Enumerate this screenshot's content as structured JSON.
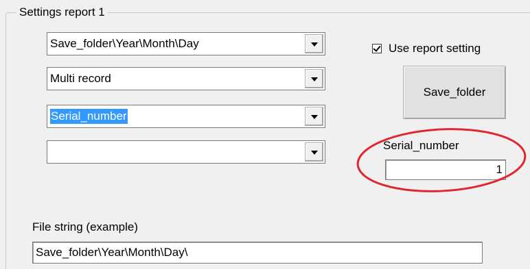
{
  "group": {
    "title": "Settings report 1"
  },
  "combos": [
    {
      "value": "Save_folder\\Year\\Month\\Day",
      "selected": false
    },
    {
      "value": "Multi record",
      "selected": false
    },
    {
      "value": "Serial_number",
      "selected": true
    },
    {
      "value": "",
      "selected": false
    }
  ],
  "use_report_setting": {
    "label": "Use report setting",
    "checked": true
  },
  "save_folder_button": {
    "label": "Save_folder"
  },
  "serial_number": {
    "label": "Serial_number",
    "value": "1"
  },
  "file_string": {
    "label": "File string (example)",
    "value": "Save_folder\\Year\\Month\\Day\\"
  },
  "colors": {
    "annotation": "#e0262e",
    "selection": "#3399ff"
  },
  "icons": {
    "dropdown": "chevron-down-icon",
    "check": "checkmark-icon"
  }
}
